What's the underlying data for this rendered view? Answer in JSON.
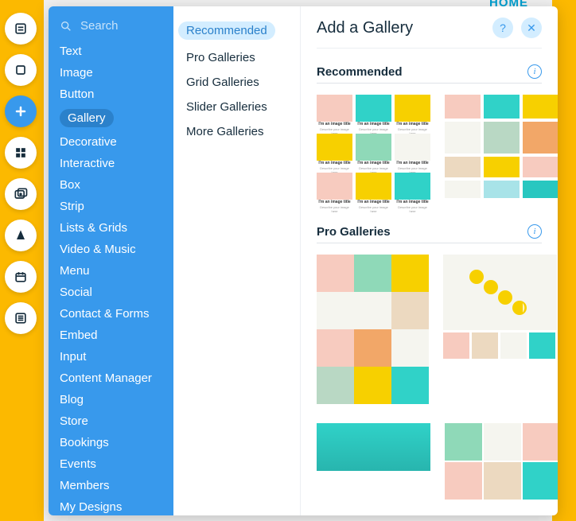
{
  "header": {
    "home": "HOME"
  },
  "sidebar": {
    "search_placeholder": "Search",
    "categories": [
      "Text",
      "Image",
      "Button",
      "Gallery",
      "Decorative",
      "Interactive",
      "Box",
      "Strip",
      "Lists & Grids",
      "Video & Music",
      "Menu",
      "Social",
      "Contact & Forms",
      "Embed",
      "Input",
      "Content Manager",
      "Blog",
      "Store",
      "Bookings",
      "Events",
      "Members",
      "My Designs"
    ],
    "selected": "Gallery"
  },
  "sub": {
    "items": [
      "Recommended",
      "Pro Galleries",
      "Grid Galleries",
      "Slider Galleries",
      "More Galleries"
    ],
    "selected": "Recommended"
  },
  "content": {
    "title": "Add a Gallery",
    "sections": {
      "recommended": "Recommended",
      "pro": "Pro Galleries"
    },
    "sample_caption_title": "I'm an image title",
    "sample_caption_sub": "Describe your image here"
  },
  "colors": {
    "pink": "#f7cbbf",
    "teal": "#30d2c8",
    "yellow": "#f7d000",
    "mint": "#8fd9b8",
    "sage": "#b9d8c4",
    "white": "#f5f5ef",
    "orange": "#f2a768",
    "sky": "#a8e3e8",
    "sand": "#ecd9c0",
    "aqua": "#28c7c0"
  }
}
